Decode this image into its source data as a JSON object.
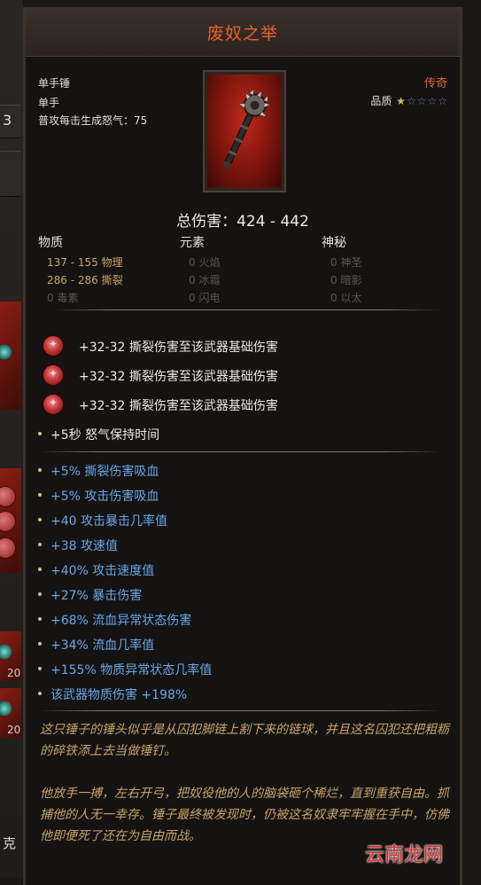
{
  "item": {
    "title": "废奴之举",
    "type_line_1": "单手锤",
    "type_line_2": "单手",
    "rage_line": "普攻每击生成怒气：75",
    "rarity": "传奇",
    "quality_label": "品质",
    "quality_stars": 1,
    "quality_max": 5,
    "total_damage": "总伤害：424 - 442"
  },
  "damage": {
    "headers": [
      "物质",
      "元素",
      "神秘"
    ],
    "physical": [
      {
        "value": "137 - 155",
        "label": "物理",
        "active": true
      },
      {
        "value": "286 - 286",
        "label": "撕裂",
        "active": true
      },
      {
        "value": "0",
        "label": "毒素",
        "active": false
      }
    ],
    "elemental": [
      {
        "value": "0",
        "label": "火焰"
      },
      {
        "value": "0",
        "label": "冰霜"
      },
      {
        "value": "0",
        "label": "闪电"
      }
    ],
    "arcane": [
      {
        "value": "0",
        "label": "神圣"
      },
      {
        "value": "0",
        "label": "暗影"
      },
      {
        "value": "0",
        "label": "以太"
      }
    ]
  },
  "gems": [
    "+32-32 撕裂伤害至该武器基础伤害",
    "+32-32 撕裂伤害至该武器基础伤害",
    "+32-32 撕裂伤害至该武器基础伤害"
  ],
  "rage_bonus": "+5秒 怒气保持时间",
  "affixes": [
    "+5% 撕裂伤害吸血",
    "+5% 攻击伤害吸血",
    "+40 攻击暴击几率值",
    "+38 攻速值",
    "+40% 攻击速度值",
    "+27% 暴击伤害",
    "+68% 流血异常状态伤害",
    "+34% 流血几率值",
    "+155% 物质异常状态几率值",
    "该武器物质伤害 +198%"
  ],
  "lore": [
    "这只锤子的锤头似乎是从囚犯脚链上割下来的链球，并且这名囚犯还把粗粝的碎铁添上去当做锤钉。",
    "他放手一搏，左右开弓，把奴役他的人的脑袋砸个稀烂，直到重获自由。抓捕他的人无一幸存。锤子最终被发现时，仍被这名奴隶牢牢握在手中，仿佛他即便死了还在为自由而战。"
  ],
  "background": {
    "left_number": "3",
    "left_number_2": "20",
    "left_number_3": "20",
    "left_text": "克"
  },
  "watermark": "云南龙网",
  "colors": {
    "legendary": "#e8622f",
    "affix_blue": "#6aa6e6",
    "lore_gold": "#c9a466"
  }
}
